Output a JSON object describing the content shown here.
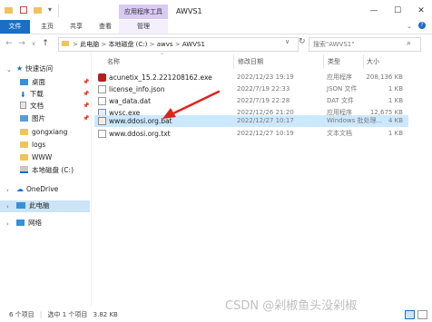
{
  "window": {
    "title": "AWVS1",
    "context_tab": "应用程序工具",
    "quick_access_icons": [
      "folder-icon",
      "checkbox-icon",
      "folder-icon"
    ],
    "controls": {
      "minimize": "—",
      "maximize": "☐",
      "close": "✕"
    }
  },
  "ribbon": {
    "tabs": [
      "文件",
      "主页",
      "共享",
      "查看",
      "管理"
    ]
  },
  "address": {
    "path": [
      "此电脑",
      "本地磁盘 (C:)",
      "awvs",
      "AWVS1"
    ],
    "search_placeholder": "搜索\"AWVS1\""
  },
  "nav": {
    "quick_access": "快速访问",
    "items": [
      {
        "label": "桌面",
        "pinned": true
      },
      {
        "label": "下载",
        "pinned": true
      },
      {
        "label": "文档",
        "pinned": true
      },
      {
        "label": "图片",
        "pinned": true
      },
      {
        "label": "gongxiang",
        "pinned": false
      },
      {
        "label": "logs",
        "pinned": false
      },
      {
        "label": "WWW",
        "pinned": false
      },
      {
        "label": "本地磁盘 (C:)",
        "pinned": false
      }
    ],
    "onedrive": "OneDrive",
    "this_pc": "此电脑",
    "network": "网络"
  },
  "columns": {
    "name": "名称",
    "date": "修改日期",
    "type": "类型",
    "size": "大小"
  },
  "files": [
    {
      "name": "acunetix_15.2.221208162.exe",
      "date": "2022/12/23 19:19",
      "type": "应用程序",
      "size": "208,136 KB",
      "icon": "acunetix-exe-icon"
    },
    {
      "name": "license_info.json",
      "date": "2022/7/19 22:33",
      "type": "JSON 文件",
      "size": "1 KB",
      "icon": "json-file-icon"
    },
    {
      "name": "wa_data.dat",
      "date": "2022/7/19 22:28",
      "type": "DAT 文件",
      "size": "1 KB",
      "icon": "dat-file-icon"
    },
    {
      "name": "wvsc.exe",
      "date": "2022/12/26 21:20",
      "type": "应用程序",
      "size": "12,675 KB",
      "icon": "exe-file-icon"
    },
    {
      "name": "www.ddosi.org.bat",
      "date": "2022/12/27 10:17",
      "type": "Windows 批处理...",
      "size": "4 KB",
      "icon": "bat-file-icon",
      "selected": true
    },
    {
      "name": "www.ddosi.org.txt",
      "date": "2022/12/27 10:19",
      "type": "文本文档",
      "size": "1 KB",
      "icon": "txt-file-icon"
    }
  ],
  "status": {
    "count": "6 个项目",
    "selected": "选中 1 个项目",
    "size": "3.82 KB"
  },
  "watermark": "CSDN @剁椒鱼头没剁椒",
  "colors": {
    "accent": "#1a6fc4",
    "selected_row": "#cce8ff",
    "context_tab": "#d9c9f5",
    "arrow": "#e0221c"
  }
}
